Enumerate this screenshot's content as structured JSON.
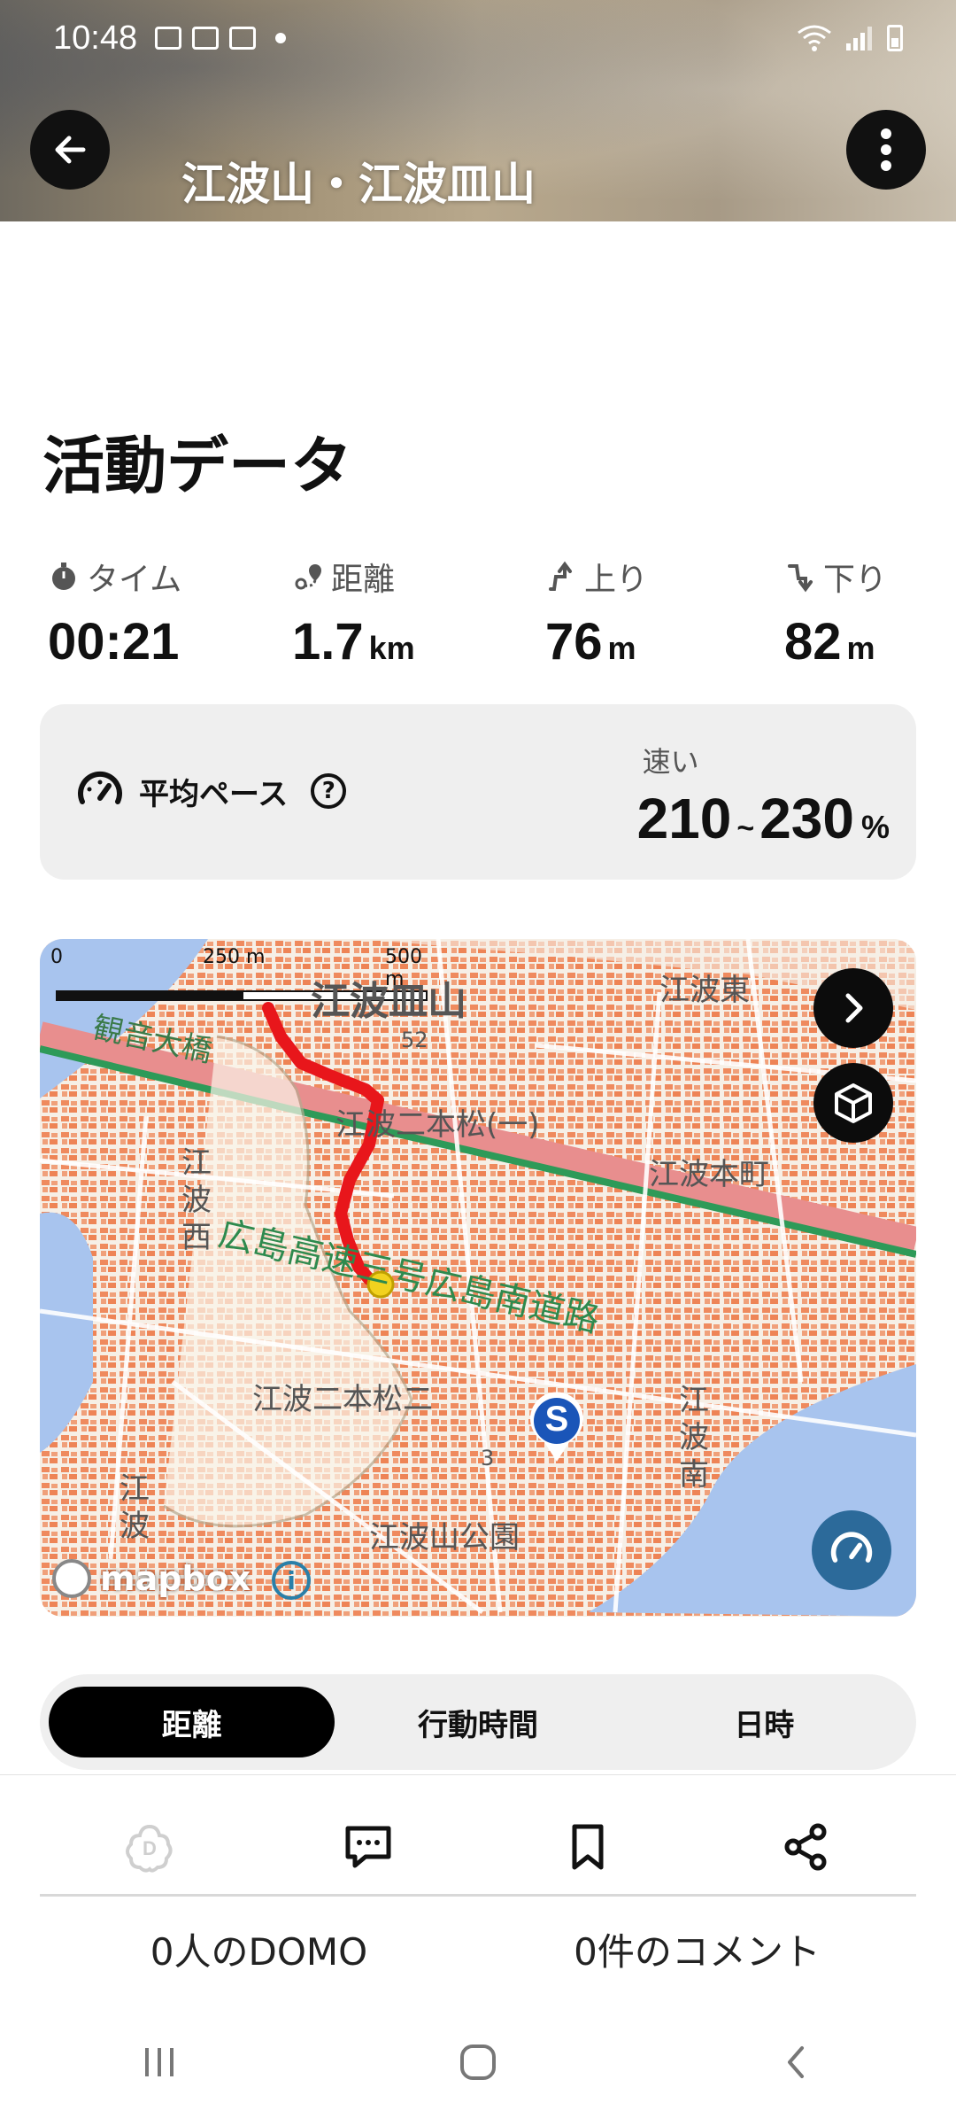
{
  "status_bar": {
    "time": "10:48"
  },
  "header": {
    "title": "江波山・江波皿山"
  },
  "activity": {
    "section_title": "活動データ",
    "stats": [
      {
        "label": "タイム",
        "value": "00:21",
        "unit": "",
        "icon": "stopwatch-icon"
      },
      {
        "label": "距離",
        "value": "1.7",
        "unit": "km",
        "icon": "route-icon"
      },
      {
        "label": "上り",
        "value": "76",
        "unit": "m",
        "icon": "ascent-icon"
      },
      {
        "label": "下り",
        "value": "82",
        "unit": "m",
        "icon": "descent-icon"
      }
    ],
    "pace": {
      "label": "平均ペース",
      "help": "?",
      "speed_label": "速い",
      "range_low": "210",
      "tilde": "~",
      "range_high": "230",
      "unit": "%"
    }
  },
  "map": {
    "scale_labels": [
      "0",
      "250 m",
      "500 m"
    ],
    "place_labels": [
      "江波皿山",
      "江波東",
      "観音大橋",
      "江波二本松(一)",
      "江波本町",
      "江波西",
      "広島高速三号広島南道路",
      "江波二本松二",
      "江波南",
      "江波",
      "江波山公園",
      "52",
      "3"
    ],
    "start_marker": "S",
    "attribution": "mapbox",
    "colors": {
      "route": "#e8161b",
      "water": "#a8c4ee",
      "start_marker": "#1a55b8"
    }
  },
  "tabs": {
    "items": [
      "距離",
      "行動時間",
      "日時"
    ],
    "active": 0
  },
  "social": {
    "domo_count": "0人のDOMO",
    "comment_count": "0件のコメント"
  }
}
